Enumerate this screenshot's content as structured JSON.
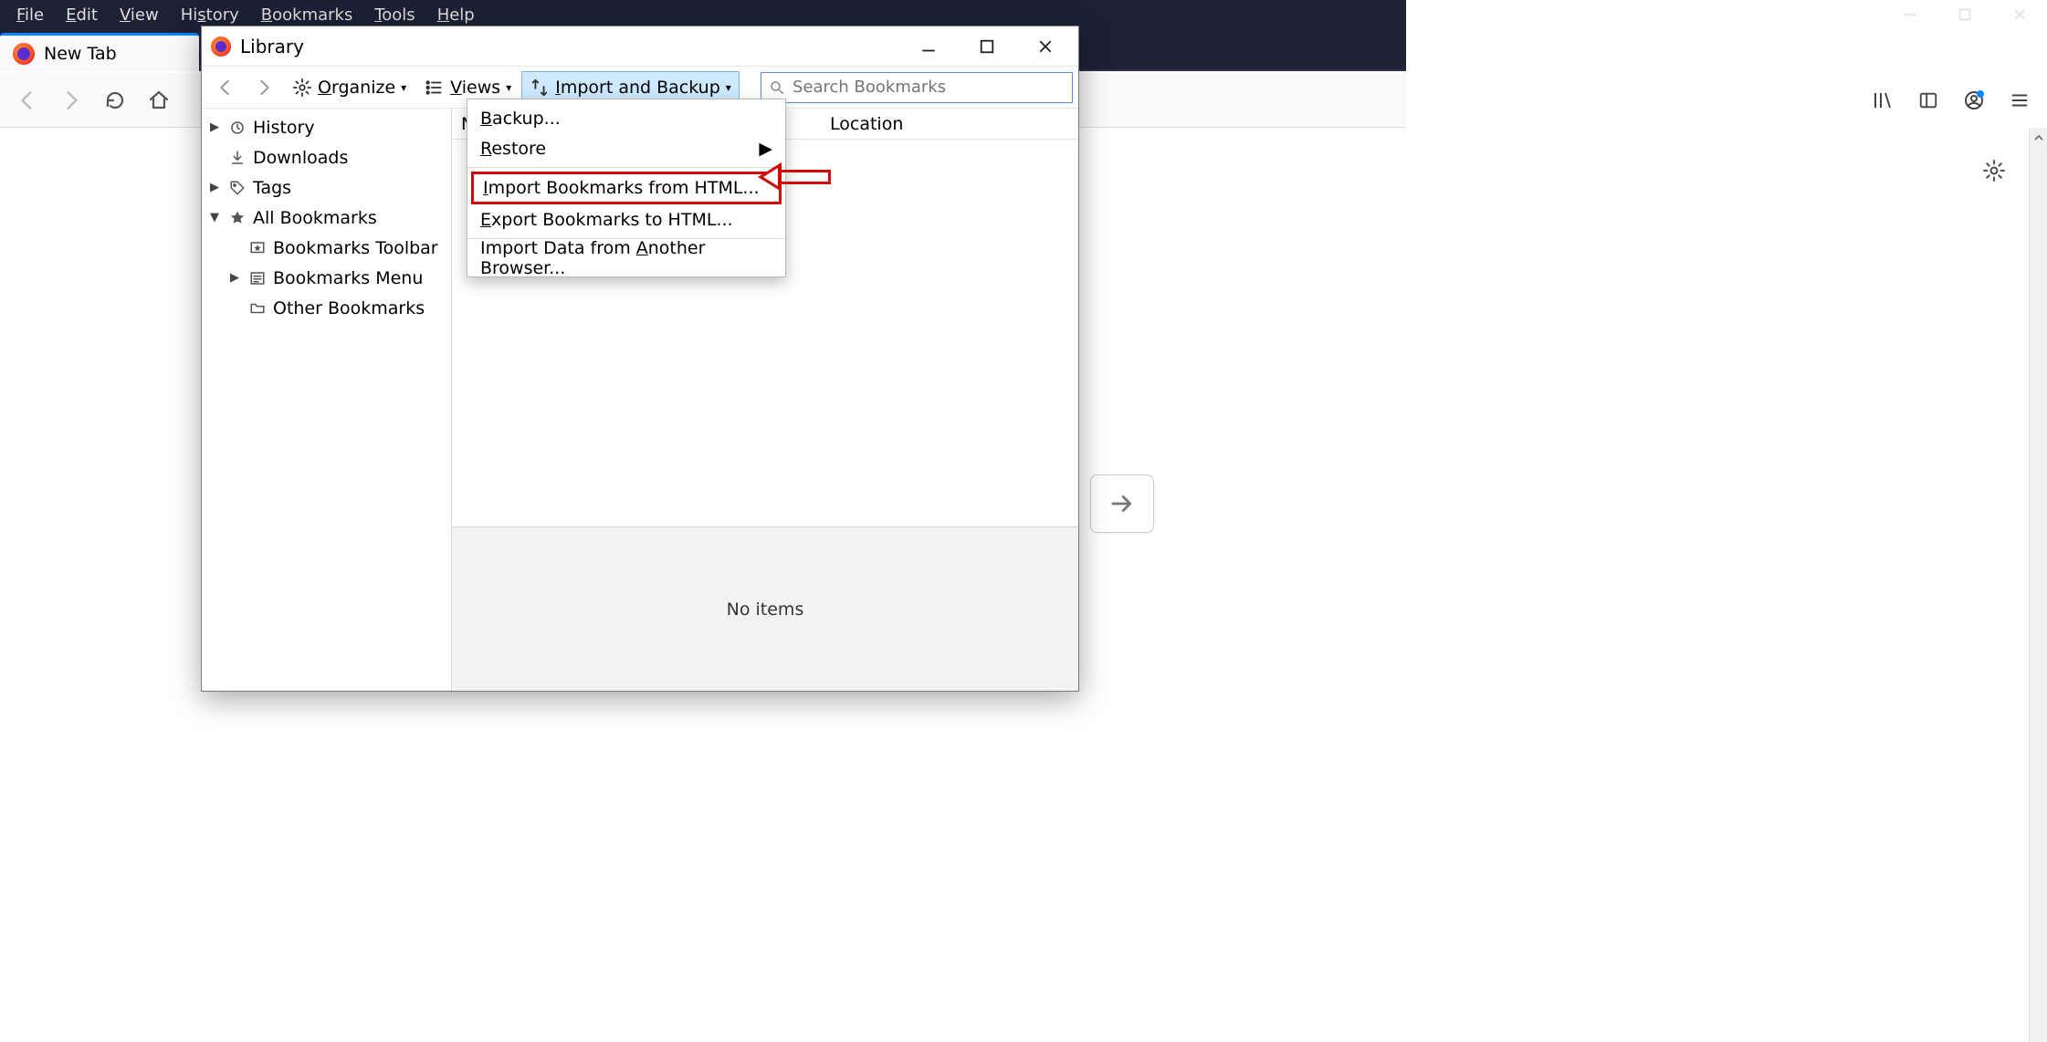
{
  "menubar": {
    "items": [
      {
        "ul": "F",
        "rest": "ile"
      },
      {
        "ul": "E",
        "rest": "dit"
      },
      {
        "ul": "V",
        "rest": "iew"
      },
      {
        "pre": "Hi",
        "ul": "s",
        "rest": "tory"
      },
      {
        "ul": "B",
        "rest": "ookmarks"
      },
      {
        "ul": "T",
        "rest": "ools"
      },
      {
        "ul": "H",
        "rest": "elp"
      }
    ]
  },
  "tab": {
    "title": "New Tab"
  },
  "library": {
    "title": "Library",
    "toolbar": {
      "organize": "Organize",
      "views": "Views",
      "import_backup": "Import and Backup"
    },
    "search_placeholder": "Search Bookmarks",
    "sidebar": {
      "history": "History",
      "downloads": "Downloads",
      "tags": "Tags",
      "all_bookmarks": "All Bookmarks",
      "bookmarks_toolbar": "Bookmarks Toolbar",
      "bookmarks_menu": "Bookmarks Menu",
      "other_bookmarks": "Other Bookmarks"
    },
    "columns": {
      "name": "N",
      "location": "Location"
    },
    "detail_empty": "No items"
  },
  "dropdown": {
    "backup": "Backup...",
    "restore": "Restore",
    "import_html": "Import Bookmarks from HTML...",
    "export_html": "Export Bookmarks to HTML...",
    "import_other": "Import Data from Another Browser..."
  }
}
